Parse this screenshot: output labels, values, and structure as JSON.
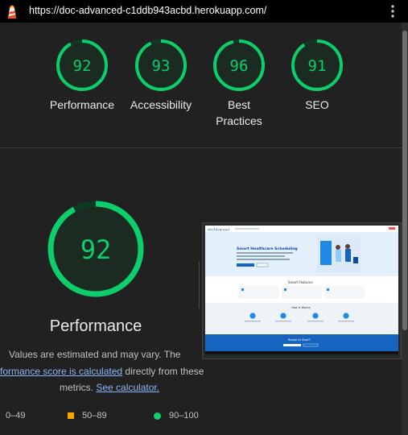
{
  "browser": {
    "url": "https://doc-advanced-c1ddb943acbd.herokuapp.com/"
  },
  "summary": [
    {
      "score": "92",
      "label": "Performance",
      "value": 0.92
    },
    {
      "score": "93",
      "label": "Accessibility",
      "value": 0.93
    },
    {
      "score": "96",
      "label": "Best Practices",
      "value": 0.96
    },
    {
      "score": "91",
      "label": "SEO",
      "value": 0.91
    }
  ],
  "performance": {
    "score": "92",
    "value": 0.92,
    "title": "Performance",
    "note_line1": "Values are estimated and may vary. The",
    "note_link1": "formance score is calculated",
    "note_line2_rest": " directly from these",
    "note_line3_start": "metrics. ",
    "note_link2": "See calculator."
  },
  "screenshot": {
    "brand": "docAdvanced",
    "hero_title": "Smart Healthcare Scheduling",
    "features_title": "Smart Features",
    "how_title": "How it Works",
    "cta_title": "Ready to Start?"
  },
  "legend": [
    {
      "label": "0–49"
    },
    {
      "label": "50–89"
    },
    {
      "label": "90–100"
    }
  ],
  "colors": {
    "pass": "#0cce6b",
    "average": "#ffa400",
    "fail": "#ff4e42",
    "gauge_track": "#0d3b22"
  }
}
